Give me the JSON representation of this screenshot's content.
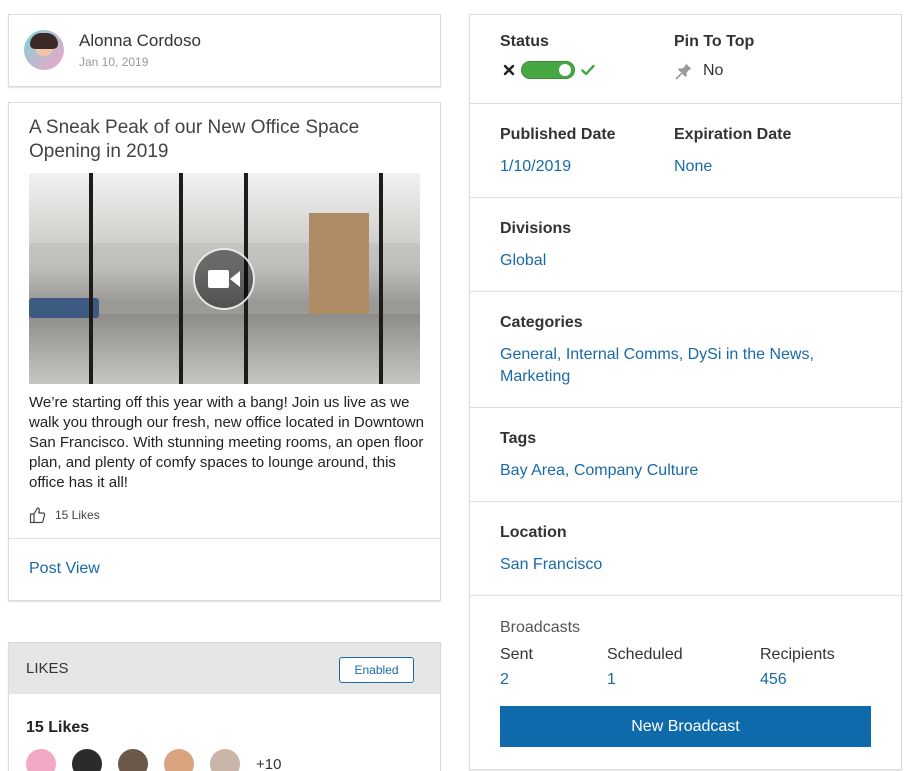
{
  "author": {
    "name": "Alonna Cordoso",
    "date": "Jan 10, 2019"
  },
  "post": {
    "title": "A Sneak Peak of our New Office Space Opening in 2019",
    "body": "We’re starting off this year with a bang! Join us live as we walk you through our fresh, new office located in Downtown San Francisco. With stunning meeting rooms, an open floor plan, and plenty of comfy spaces to lounge around, this office has it all!",
    "likes_label": "15 Likes",
    "view_link": "Post View"
  },
  "likes_panel": {
    "header": "LIKES",
    "badge": "Enabled",
    "count_label": "15 Likes",
    "more_label": "+10",
    "avatar_colors": [
      "#f3a9c5",
      "#2b2b2b",
      "#6b5848",
      "#d9a37f",
      "#c9b6a8"
    ]
  },
  "details": {
    "status": {
      "label": "Status",
      "enabled": true,
      "off_icon": "x-icon",
      "on_icon": "check-icon"
    },
    "pin": {
      "label": "Pin To Top",
      "value": "No",
      "icon": "pin-icon"
    },
    "published": {
      "label": "Published Date",
      "value": "1/10/2019"
    },
    "expiration": {
      "label": "Expiration Date",
      "value": "None"
    },
    "divisions": {
      "label": "Divisions",
      "value": "Global"
    },
    "categories": {
      "label": "Categories",
      "line1": "General, Internal Comms, DySi in the News,",
      "line2": "Marketing"
    },
    "tags": {
      "label": "Tags",
      "value": "Bay Area, Company Culture"
    },
    "location": {
      "label": "Location",
      "value": "San Francisco"
    },
    "broadcasts": {
      "label": "Broadcasts",
      "sent_label": "Sent",
      "sent_value": "2",
      "scheduled_label": "Scheduled",
      "scheduled_value": "1",
      "recipients_label": "Recipients",
      "recipients_value": "456",
      "button_label": "New Broadcast"
    }
  },
  "colors": {
    "link": "#1a6aa6",
    "primary_button": "#0f6aac",
    "toggle_on": "#45a843"
  }
}
